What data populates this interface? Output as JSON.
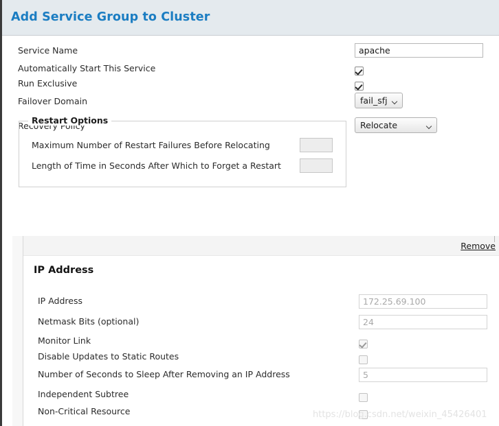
{
  "header": {
    "title": "Add Service Group to Cluster",
    "accent_color": "#1b7dc2",
    "background_color": "#e4eaee"
  },
  "service_form": {
    "rows": [
      {
        "label": "Service Name",
        "type": "text",
        "value": "apache"
      },
      {
        "label": "Automatically Start This Service",
        "type": "checkbox",
        "checked": true
      },
      {
        "label": "Run Exclusive",
        "type": "checkbox",
        "checked": true
      },
      {
        "label": "Failover Domain",
        "type": "select",
        "value": "fail_sfj"
      },
      {
        "label": "Recovery Policy",
        "type": "select",
        "value": "Relocate"
      }
    ]
  },
  "restart_options": {
    "legend": "Restart Options",
    "rows": [
      {
        "label": "Maximum Number of Restart Failures Before Relocating",
        "value": ""
      },
      {
        "label": "Length of Time in Seconds After Which to Forget a Restart",
        "value": ""
      }
    ]
  },
  "resource_panel": {
    "remove_label": "Remove",
    "title": "IP Address",
    "rows": [
      {
        "label": "IP Address",
        "type": "text",
        "placeholder": "172.25.69.100"
      },
      {
        "label": "Netmask Bits (optional)",
        "type": "text",
        "placeholder": "24"
      },
      {
        "label": "Monitor Link",
        "type": "checkbox",
        "checked": true
      },
      {
        "label": "Disable Updates to Static Routes",
        "type": "checkbox",
        "checked": false
      },
      {
        "label": "Number of Seconds to Sleep After Removing an IP Address",
        "type": "text",
        "placeholder": "5"
      },
      {
        "label": "Independent Subtree",
        "type": "checkbox",
        "checked": false
      },
      {
        "label": "Non-Critical Resource",
        "type": "checkbox",
        "checked": false
      }
    ]
  },
  "watermark": {
    "text": "https://blog.csdn.net/weixin_45426401"
  }
}
